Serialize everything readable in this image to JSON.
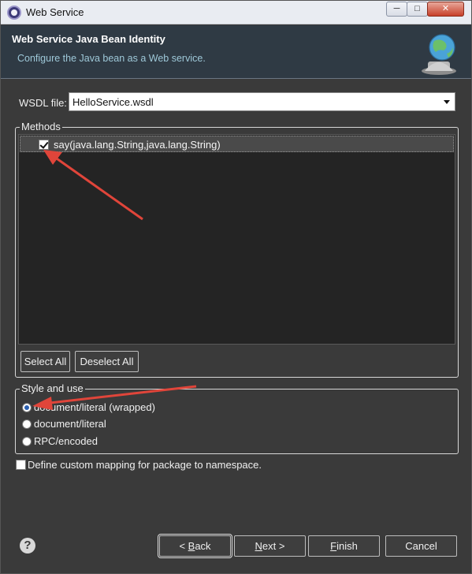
{
  "window": {
    "title": "Web Service",
    "controls": {
      "minimize": "─",
      "maximize": "□",
      "close": "✕"
    }
  },
  "banner": {
    "heading": "Web Service Java Bean Identity",
    "description": "Configure the Java bean as a Web service.",
    "icon": "globe-icon"
  },
  "wsdl": {
    "label": "WSDL file:",
    "value": "HelloService.wsdl"
  },
  "methods": {
    "group_label": "Methods",
    "items": [
      {
        "label": "say(java.lang.String,java.lang.String)",
        "checked": true
      }
    ],
    "select_all": "Select All",
    "deselect_all": "Deselect All"
  },
  "style": {
    "group_label": "Style and use",
    "options": [
      {
        "label": "document/literal (wrapped)",
        "selected": true
      },
      {
        "label": "document/literal",
        "selected": false
      },
      {
        "label": "RPC/encoded",
        "selected": false
      }
    ]
  },
  "custom_mapping": {
    "label": "Define custom mapping for package to namespace.",
    "checked": false
  },
  "footer": {
    "back": "< Back",
    "next": "Next >",
    "finish": "Finish",
    "cancel": "Cancel"
  },
  "colors": {
    "annotation_arrow": "#e0453a",
    "dialog_background": "#3a3a3a",
    "banner_background": "#2f3a44"
  }
}
